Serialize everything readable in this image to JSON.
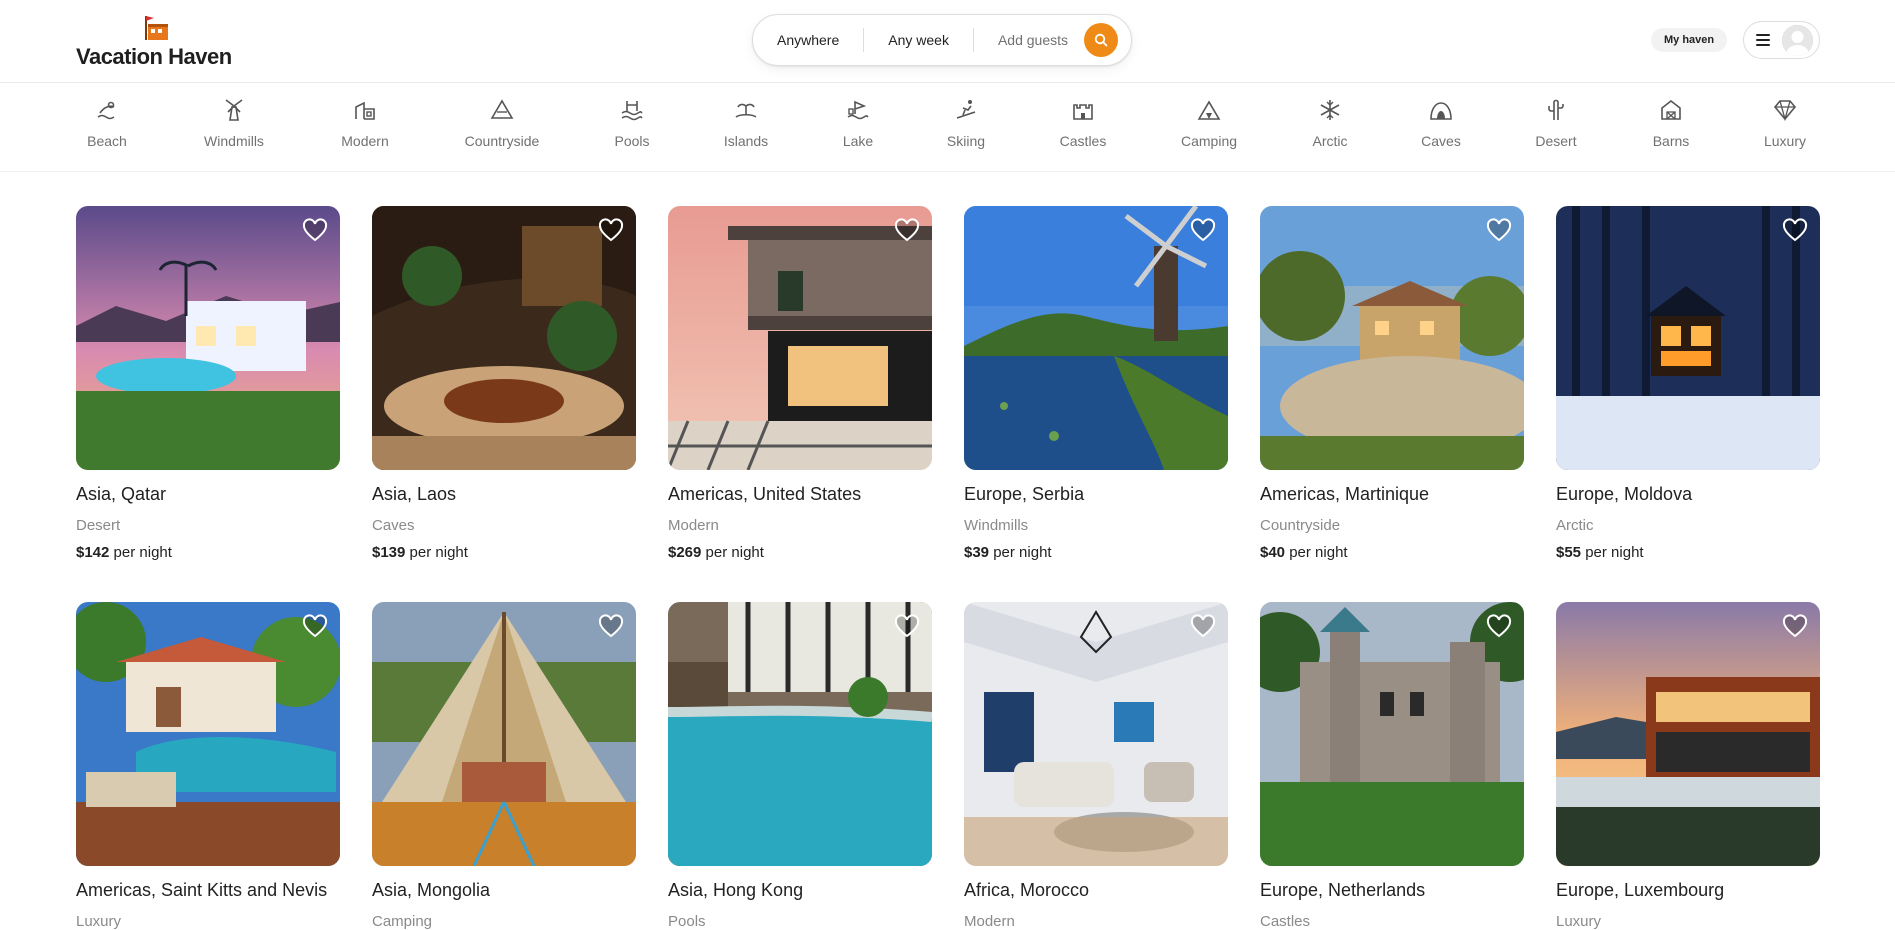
{
  "brand": {
    "name": "Vacation Haven",
    "logo_icon": "house-flag-icon",
    "accent": "#f08a16"
  },
  "search": {
    "where": "Anywhere",
    "when": "Any week",
    "guests": "Add guests",
    "button_icon": "search-icon"
  },
  "user": {
    "my_haven": "My haven",
    "menu_icon": "hamburger-icon",
    "avatar_icon": "avatar-icon"
  },
  "categories": [
    {
      "label": "Beach",
      "icon": "beach-icon"
    },
    {
      "label": "Windmills",
      "icon": "windmill-icon"
    },
    {
      "label": "Modern",
      "icon": "modern-house-icon"
    },
    {
      "label": "Countryside",
      "icon": "mountain-icon"
    },
    {
      "label": "Pools",
      "icon": "pool-icon"
    },
    {
      "label": "Islands",
      "icon": "island-icon"
    },
    {
      "label": "Lake",
      "icon": "lake-icon"
    },
    {
      "label": "Skiing",
      "icon": "skiing-icon"
    },
    {
      "label": "Castles",
      "icon": "castle-icon"
    },
    {
      "label": "Camping",
      "icon": "camping-icon"
    },
    {
      "label": "Arctic",
      "icon": "snowflake-icon"
    },
    {
      "label": "Caves",
      "icon": "cave-icon"
    },
    {
      "label": "Desert",
      "icon": "cactus-icon"
    },
    {
      "label": "Barns",
      "icon": "barn-icon"
    },
    {
      "label": "Luxury",
      "icon": "diamond-icon"
    }
  ],
  "listings": [
    {
      "location": "Asia, Qatar",
      "category": "Desert",
      "price": "$142",
      "per": "per night"
    },
    {
      "location": "Asia, Laos",
      "category": "Caves",
      "price": "$139",
      "per": "per night"
    },
    {
      "location": "Americas, United States",
      "category": "Modern",
      "price": "$269",
      "per": "per night"
    },
    {
      "location": "Europe, Serbia",
      "category": "Windmills",
      "price": "$39",
      "per": "per night"
    },
    {
      "location": "Americas, Martinique",
      "category": "Countryside",
      "price": "$40",
      "per": "per night"
    },
    {
      "location": "Europe, Moldova",
      "category": "Arctic",
      "price": "$55",
      "per": "per night"
    },
    {
      "location": "Americas, Saint Kitts and Nevis",
      "category": "Luxury",
      "price": "",
      "per": ""
    },
    {
      "location": "Asia, Mongolia",
      "category": "Camping",
      "price": "",
      "per": ""
    },
    {
      "location": "Asia, Hong Kong",
      "category": "Pools",
      "price": "",
      "per": ""
    },
    {
      "location": "Africa, Morocco",
      "category": "Modern",
      "price": "",
      "per": ""
    },
    {
      "location": "Europe, Netherlands",
      "category": "Castles",
      "price": "",
      "per": ""
    },
    {
      "location": "Europe, Luxembourg",
      "category": "Luxury",
      "price": "",
      "per": ""
    }
  ]
}
